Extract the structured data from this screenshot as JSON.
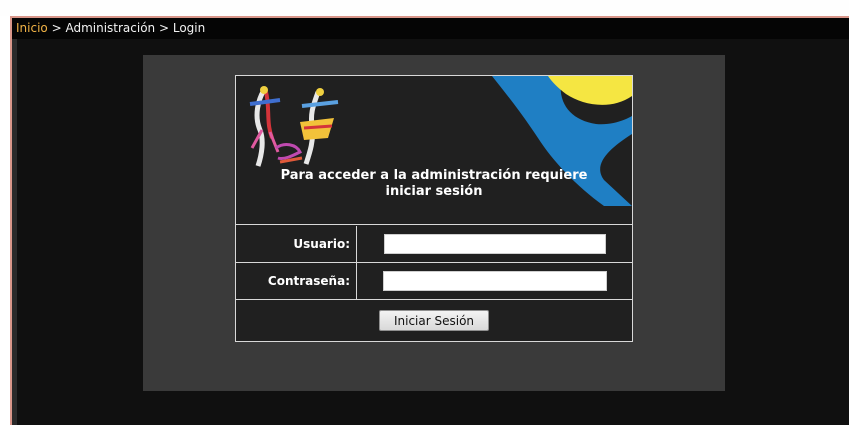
{
  "breadcrumb": {
    "home": "Inicio",
    "sep1": " > ",
    "section": "Administración",
    "sep2": " > ",
    "current": "Login"
  },
  "login": {
    "message": "Para acceder a la administración requiere iniciar sesión",
    "user_label": "Usuario:",
    "user_value": "",
    "password_label": "Contraseña:",
    "password_value": "",
    "submit_label": "Iniciar Sesión"
  },
  "colors": {
    "breadcrumb_link": "#f0b246",
    "frame_border": "#d9968a",
    "decor_yellow": "#f5e642",
    "decor_blue": "#1f7fc4"
  }
}
